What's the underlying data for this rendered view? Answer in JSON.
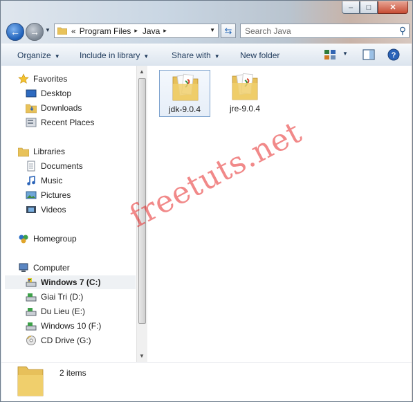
{
  "address": {
    "overflow_glyph": "«",
    "crumbs": [
      "Program Files",
      "Java"
    ],
    "separator": "▸"
  },
  "search": {
    "placeholder": "Search Java"
  },
  "caption": {
    "minimize": "–",
    "maximize": "□",
    "close": "✕"
  },
  "toolbar": {
    "organize": "Organize",
    "include_in_library": "Include in library",
    "share_with": "Share with",
    "new_folder": "New folder",
    "icons": [
      "change-view-icon",
      "preview-pane-icon",
      "help-icon"
    ]
  },
  "nav": {
    "favorites": {
      "label": "Favorites",
      "items": [
        "Desktop",
        "Downloads",
        "Recent Places"
      ]
    },
    "libraries": {
      "label": "Libraries",
      "items": [
        "Documents",
        "Music",
        "Pictures",
        "Videos"
      ]
    },
    "homegroup": {
      "label": "Homegroup"
    },
    "computer": {
      "label": "Computer",
      "items": [
        "Windows 7 (C:)",
        "Giai Tri (D:)",
        "Du Lieu (E:)",
        "Windows 10 (F:)",
        "CD Drive (G:)"
      ],
      "selected": "Windows 7 (C:)"
    }
  },
  "files": [
    {
      "name": "jdk-9.0.4",
      "type": "folder",
      "selected": true
    },
    {
      "name": "jre-9.0.4",
      "type": "folder",
      "selected": false
    }
  ],
  "watermark": "freetuts.net",
  "details": {
    "count": "2 items"
  },
  "colors": {
    "accent": "#1e395b",
    "selection_border": "#7da2ce",
    "watermark": "#e62828"
  }
}
